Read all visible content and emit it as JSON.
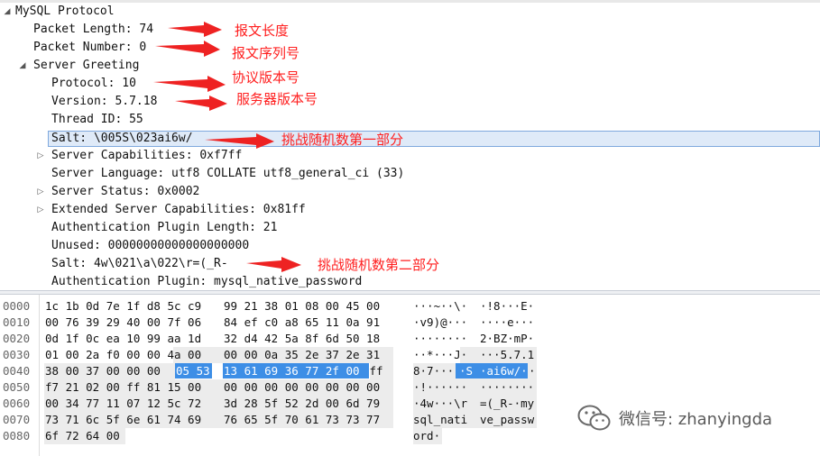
{
  "tree": {
    "mysql": "MySQL Protocol",
    "packet_length": "Packet Length: 74",
    "packet_number": "Packet Number: 0",
    "server_greeting": "Server Greeting",
    "protocol": "Protocol: 10",
    "version": "Version: 5.7.18",
    "thread_id": "Thread ID: 55",
    "salt1": "Salt: \\005S\\023ai6w/",
    "server_capabilities": "Server Capabilities: 0xf7ff",
    "server_language": "Server Language: utf8 COLLATE utf8_general_ci (33)",
    "server_status": "Server Status: 0x0002",
    "extended_caps": "Extended Server Capabilities: 0x81ff",
    "auth_plugin_length": "Authentication Plugin Length: 21",
    "unused": "Unused: 00000000000000000000",
    "salt2": "Salt: 4w\\021\\a\\022\\r=(_R-",
    "auth_plugin": "Authentication Plugin: mysql_native_password"
  },
  "annotations": {
    "packet_length": "报文长度",
    "packet_number": "报文序列号",
    "protocol": "协议版本号",
    "version": "服务器版本号",
    "salt1": "挑战随机数第一部分",
    "salt2": "挑战随机数第二部分"
  },
  "hex": {
    "offsets": [
      "0000",
      "0010",
      "0020",
      "0030",
      "0040",
      "0050",
      "0060",
      "0070",
      "0080"
    ],
    "row0": {
      "a": "1c 1b 0d 7e 1f d8 5c c9",
      "b": "99 21 38 01 08 00 45 00",
      "asc_a": "···~··\\·",
      "asc_b": "·!8···E·"
    },
    "row1": {
      "a": "00 76 39 29 40 00 7f 06",
      "b": "84 ef c0 a8 65 11 0a 91",
      "asc_a": "·v9)@···",
      "asc_b": "····e···"
    },
    "row2": {
      "a": "0d 1f 0c ea 10 99 aa 1d",
      "b": "32 d4 42 5a 8f 6d 50 18",
      "asc_a": "········",
      "asc_b": "2·BZ·mP·"
    },
    "row3": {
      "a": "01 00 2a f0 00 00 4a 00",
      "b": "00 00 0a 35 2e 37 2e 31",
      "asc_a": "··*···J·",
      "asc_b": "···5.7.1"
    },
    "row4": {
      "a_plain": "38 00 37 00 00 00 ",
      "a_hl": "05 53",
      "b_hl": "13 61 69 36 77 2f 00",
      "b_plain": " ff",
      "asc_a_plain": "8·7···",
      "asc_a_hl": "·S",
      "asc_b_hl": "·ai6w/·",
      "asc_b_plain": "·"
    },
    "row5": {
      "a": "f7 21 02 00 ff 81 15 00",
      "b": "00 00 00 00 00 00 00 00",
      "asc_a": "·!······",
      "asc_b": "········"
    },
    "row6": {
      "a": "00 34 77 11 07 12 5c 72",
      "b": "3d 28 5f 52 2d 00 6d 79",
      "asc_a": "·4w···\\r",
      "asc_b": "=(_R-·my"
    },
    "row7": {
      "a": "73 71 6c 5f 6e 61 74 69",
      "b": "76 65 5f 70 61 73 73 77",
      "asc_a": "sql_nati",
      "asc_b": "ve_passw"
    },
    "row8": {
      "a": "6f 72 64 00",
      "b": "",
      "asc_a": "ord·",
      "asc_b": ""
    }
  },
  "watermark": {
    "text": "微信号: zhanyingda",
    "icon": "wechat-icon"
  },
  "colors": {
    "annotation": "#ff2020",
    "selection": "#dfeaf8",
    "highlight": "#3d8ee6"
  }
}
